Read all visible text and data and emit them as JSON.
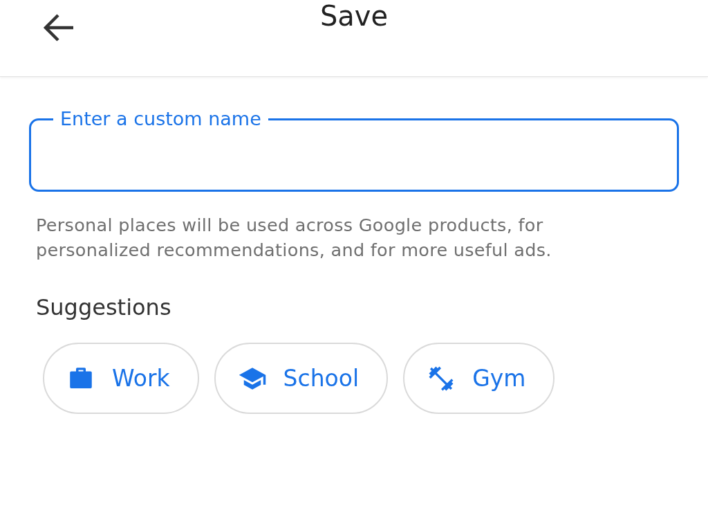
{
  "header": {
    "title": "Save"
  },
  "name_field": {
    "label": "Enter a custom name"
  },
  "helper_text": "Personal places will be used across Google products, for personalized recommendations, and for more useful ads.",
  "suggestions": {
    "heading": "Suggestions",
    "chips": [
      {
        "label": "Work",
        "kind": "work"
      },
      {
        "label": "School",
        "kind": "school"
      },
      {
        "label": "Gym",
        "kind": "gym"
      }
    ]
  }
}
